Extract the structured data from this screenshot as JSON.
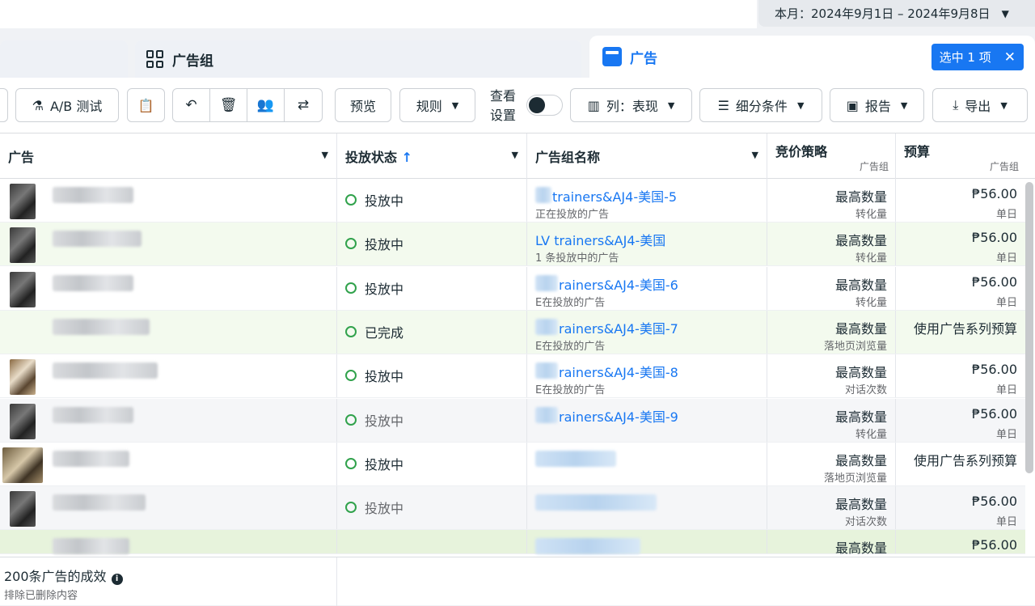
{
  "date_range": {
    "label": "本月：2024年9月1日 – 2024年9月8日"
  },
  "tabs": [
    {
      "label": ""
    },
    {
      "label": "广告组"
    },
    {
      "label": "广告"
    }
  ],
  "selection": {
    "label": "选中 1 项",
    "close": "✕"
  },
  "toolbar": {
    "ab_test": "A/B 测试",
    "preview": "预览",
    "rules": "规则",
    "view_settings_1": "查看",
    "view_settings_2": "设置",
    "columns": "列：表现",
    "breakdown": "细分条件",
    "reports": "报告",
    "export": "导出"
  },
  "headers": {
    "ad": "广告",
    "delivery": "投放状态",
    "delivery_sort_arrow": "↑",
    "adset_name": "广告组名称",
    "bid_strategy": "竞价策略",
    "bid_strategy_sub": "广告组",
    "budget": "预算",
    "budget_sub": "广告组"
  },
  "rows": [
    {
      "status": "投放中",
      "adset": "trainers&AJ4-美国-5",
      "adset_sub": "正在投放的广告",
      "bid": "最高数量",
      "bid_sub": "转化量",
      "budget": "₱56.00",
      "budget_sub": "单日"
    },
    {
      "status": "投放中",
      "adset": "LV trainers&AJ4-美国",
      "adset_sub": "1 条投放中的广告",
      "bid": "最高数量",
      "bid_sub": "转化量",
      "budget": "₱56.00",
      "budget_sub": "单日"
    },
    {
      "status": "投放中",
      "adset": "rainers&AJ4-美国-6",
      "adset_sub": "E在投放的广告",
      "bid": "最高数量",
      "bid_sub": "转化量",
      "budget": "₱56.00",
      "budget_sub": "单日"
    },
    {
      "status": "已完成",
      "adset": "rainers&AJ4-美国-7",
      "adset_sub": "E在投放的广告",
      "bid": "最高数量",
      "bid_sub": "落地页浏览量",
      "budget": "使用广告系列预算",
      "budget_sub": ""
    },
    {
      "status": "投放中",
      "adset": "rainers&AJ4-美国-8",
      "adset_sub": "E在投放的广告",
      "bid": "最高数量",
      "bid_sub": "对话次数",
      "budget": "₱56.00",
      "budget_sub": "单日"
    },
    {
      "status": "投放中",
      "adset": "rainers&AJ4-美国-9",
      "adset_sub": "",
      "bid": "最高数量",
      "bid_sub": "转化量",
      "budget": "₱56.00",
      "budget_sub": "单日"
    },
    {
      "status": "投放中",
      "adset": "",
      "adset_sub": "",
      "bid": "最高数量",
      "bid_sub": "落地页浏览量",
      "budget": "使用广告系列预算",
      "budget_sub": ""
    },
    {
      "status": "投放中",
      "adset": "",
      "adset_sub": "",
      "bid": "最高数量",
      "bid_sub": "对话次数",
      "budget": "₱56.00",
      "budget_sub": "单日"
    },
    {
      "status": "",
      "adset": "",
      "adset_sub": "",
      "bid": "最高数量",
      "bid_sub": "",
      "budget": "₱56.00",
      "budget_sub": ""
    }
  ],
  "footer": {
    "total": "200条广告的成效",
    "excluded": "排除已删除内容",
    "info_icon": "i"
  },
  "colors": {
    "accent": "#1877f2",
    "active_green": "#31a24c"
  }
}
